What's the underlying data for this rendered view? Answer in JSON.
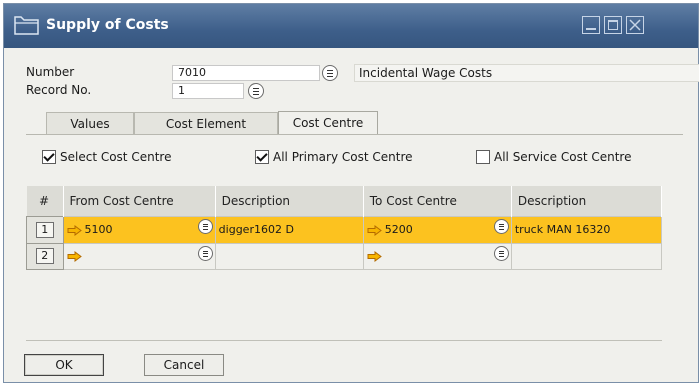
{
  "window": {
    "title": "Supply of Costs"
  },
  "header": {
    "number_label": "Number",
    "number_value": "7010",
    "description_value": "Incidental Wage Costs",
    "record_label": "Record No.",
    "record_value": "1"
  },
  "tabs": [
    {
      "label": "Values",
      "active": false
    },
    {
      "label": "Cost Element",
      "active": false
    },
    {
      "label": "Cost Centre",
      "active": true
    }
  ],
  "checkboxes": [
    {
      "label": "Select Cost Centre",
      "checked": true
    },
    {
      "label": "All Primary Cost Centre",
      "checked": true
    },
    {
      "label": "All Service Cost Centre",
      "checked": false
    }
  ],
  "grid": {
    "columns": [
      "#",
      "From Cost Centre",
      "Description",
      "To Cost Centre",
      "Description"
    ],
    "rows": [
      {
        "num": "1",
        "from": "5100",
        "from_desc": "digger1602 D",
        "to": "5200",
        "to_desc": "truck MAN 16320",
        "selected": true
      },
      {
        "num": "2",
        "from": "",
        "from_desc": "",
        "to": "",
        "to_desc": "",
        "selected": false
      }
    ]
  },
  "buttons": {
    "ok": "OK",
    "cancel": "Cancel"
  },
  "colors": {
    "titlebar": "#3e5f8a",
    "selected_row": "#fcc21f",
    "link_arrow": "#f0a000"
  },
  "icons": {
    "link": "orange-link-arrow-icon",
    "choose": "choose-from-list-icon"
  }
}
